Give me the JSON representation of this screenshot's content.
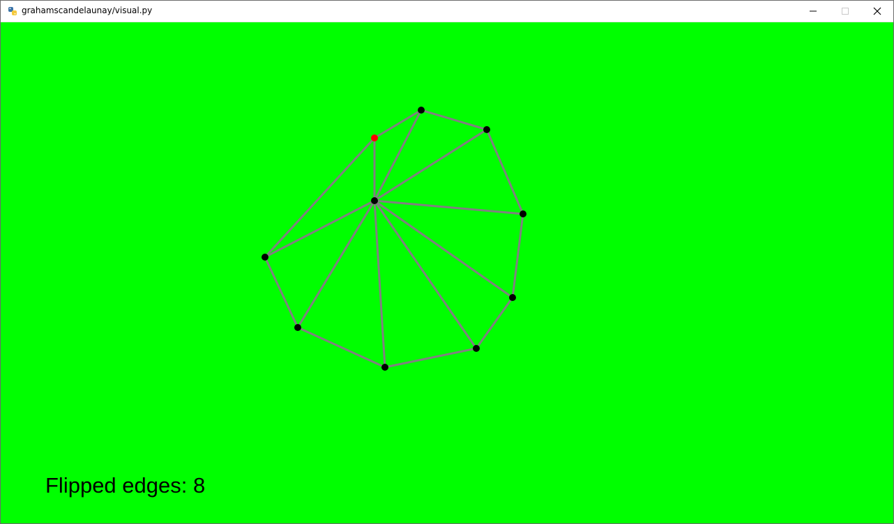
{
  "window": {
    "title": "grahamscandelaunay/visual.py",
    "icon": "python-icon",
    "controls": {
      "minimize_icon": "minimize-icon",
      "maximize_icon": "maximize-icon",
      "close_icon": "close-icon"
    }
  },
  "canvas": {
    "background_color": "#00ff00",
    "edge_color": "#808080",
    "point_color": "#000000",
    "highlight_color": "#ff0000",
    "status_text": "Flipped edges: 8"
  }
}
